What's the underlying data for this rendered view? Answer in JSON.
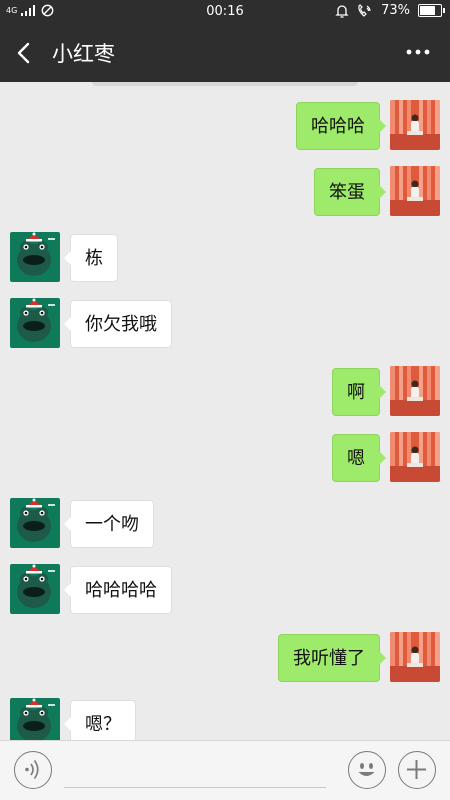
{
  "status_bar": {
    "network": "4G",
    "time": "00:16",
    "battery_percent": "73%",
    "battery_level": 0.73
  },
  "header": {
    "title": "小红枣",
    "back_icon": "chevron-left-icon",
    "more_icon": "ellipsis-icon"
  },
  "messages": [
    {
      "side": "right",
      "text": "哈哈哈",
      "avatar": "photo-avatar"
    },
    {
      "side": "right",
      "text": "笨蛋",
      "avatar": "photo-avatar"
    },
    {
      "side": "left",
      "text": "栋",
      "avatar": "frog-avatar"
    },
    {
      "side": "left",
      "text": "你欠我哦",
      "avatar": "frog-avatar"
    },
    {
      "side": "right",
      "text": "啊",
      "avatar": "photo-avatar"
    },
    {
      "side": "right",
      "text": "嗯",
      "avatar": "photo-avatar"
    },
    {
      "side": "left",
      "text": "一个吻",
      "avatar": "frog-avatar"
    },
    {
      "side": "left",
      "text": "哈哈哈哈",
      "avatar": "frog-avatar"
    },
    {
      "side": "right",
      "text": "我听懂了",
      "avatar": "photo-avatar"
    },
    {
      "side": "left",
      "text": "嗯？",
      "avatar": "frog-avatar"
    }
  ],
  "input_bar": {
    "voice_icon": "voice-icon",
    "emoji_icon": "smiley-icon",
    "plus_icon": "plus-icon"
  },
  "colors": {
    "header_bg": "#2e2e2e",
    "chat_bg": "#ebebeb",
    "sent_bubble": "#9eea6a",
    "received_bubble": "#ffffff"
  }
}
